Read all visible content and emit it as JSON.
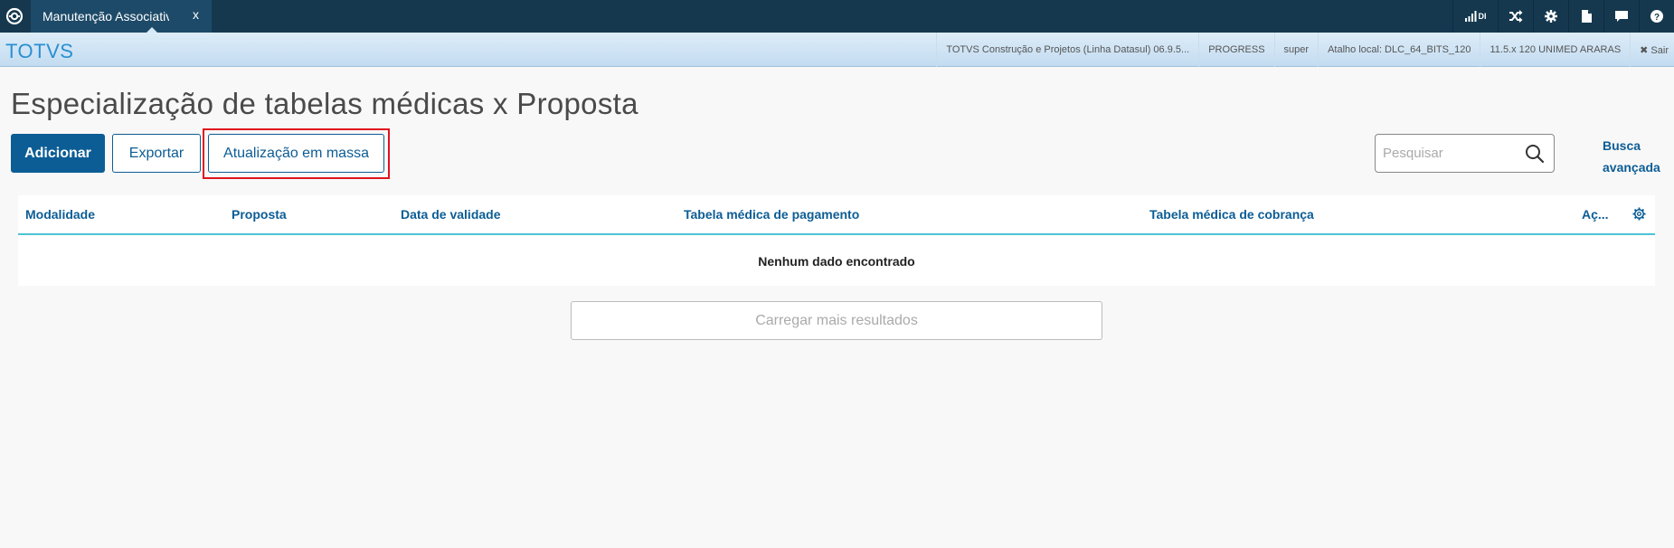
{
  "topbar": {
    "tab_label": "Manutenção Associativ",
    "tab_close": "x",
    "signal_text": "DI"
  },
  "infobar": {
    "brand": "TOTVS",
    "company": "TOTVS Construção e Projetos (Linha Datasul) 06.9.5...",
    "db": "PROGRESS",
    "user": "super",
    "shortcut": "Atalho local: DLC_64_BITS_120",
    "env": "11.5.x 120 UNIMED ARARAS",
    "exit": "✖ Sair"
  },
  "page": {
    "title": "Especialização de tabelas médicas x Proposta",
    "btn_add": "Adicionar",
    "btn_export": "Exportar",
    "btn_mass_update": "Atualização em massa",
    "search_placeholder": "Pesquisar",
    "advanced_search": "Busca avançada"
  },
  "table": {
    "columns": [
      "Modalidade",
      "Proposta",
      "Data de validade",
      "Tabela médica de pagamento",
      "Tabela médica de cobrança",
      "Aç..."
    ],
    "empty_message": "Nenhum dado encontrado",
    "load_more": "Carregar mais resultados"
  },
  "colors": {
    "topbar": "#15384f",
    "primary": "#0c5d95",
    "accent_line": "#4cc3d6",
    "highlight": "#e0141e",
    "brand": "#2a8fd1"
  }
}
